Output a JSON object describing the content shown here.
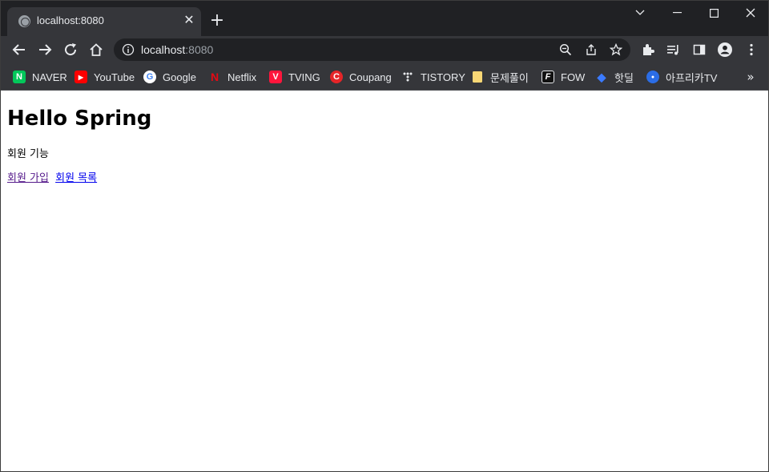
{
  "tab": {
    "title": "localhost:8080",
    "close": "✕"
  },
  "new_tab": "+",
  "omnibox": {
    "host": "localhost",
    "port": ":8080"
  },
  "bookmarks": [
    {
      "label": "NAVER",
      "icon": "naver-icon",
      "color": "#03c75a",
      "glyph": "N"
    },
    {
      "label": "YouTube",
      "icon": "youtube-icon",
      "color": "#ff0000",
      "glyph": "▶"
    },
    {
      "label": "Google",
      "icon": "google-icon",
      "color": "#ffffff",
      "glyph": "G"
    },
    {
      "label": "Netflix",
      "icon": "netflix-icon",
      "color": "#e50914",
      "glyph": "N"
    },
    {
      "label": "TVING",
      "icon": "tving-icon",
      "color": "#ff153c",
      "glyph": "V"
    },
    {
      "label": "Coupang",
      "icon": "coupang-icon",
      "color": "#e52528",
      "glyph": "C"
    },
    {
      "label": "TISTORY",
      "icon": "tistory-icon",
      "color": "#35363a",
      "glyph": "⁞"
    },
    {
      "label": "문제풀이",
      "icon": "folder-icon",
      "color": "#f8d775",
      "glyph": ""
    },
    {
      "label": "FOW",
      "icon": "fow-icon",
      "color": "#111111",
      "glyph": "F"
    },
    {
      "label": "핫딜",
      "icon": "hotdeal-icon",
      "color": "#1a53d6",
      "glyph": "◆"
    },
    {
      "label": "아프리카TV",
      "icon": "afreecatv-icon",
      "color": "#2b6de6",
      "glyph": "●"
    }
  ],
  "bookmarks_more": "»",
  "page": {
    "heading": "Hello Spring",
    "subtitle": "회원 기능",
    "links": [
      {
        "label": "회원 가입",
        "state": "visited"
      },
      {
        "label": "회원 목록",
        "state": "unvisited"
      }
    ]
  },
  "colors": {
    "titlebar": "#202124",
    "toolbar": "#35363a",
    "link_visited": "#551a8b",
    "link_unvisited": "#0000ee"
  }
}
